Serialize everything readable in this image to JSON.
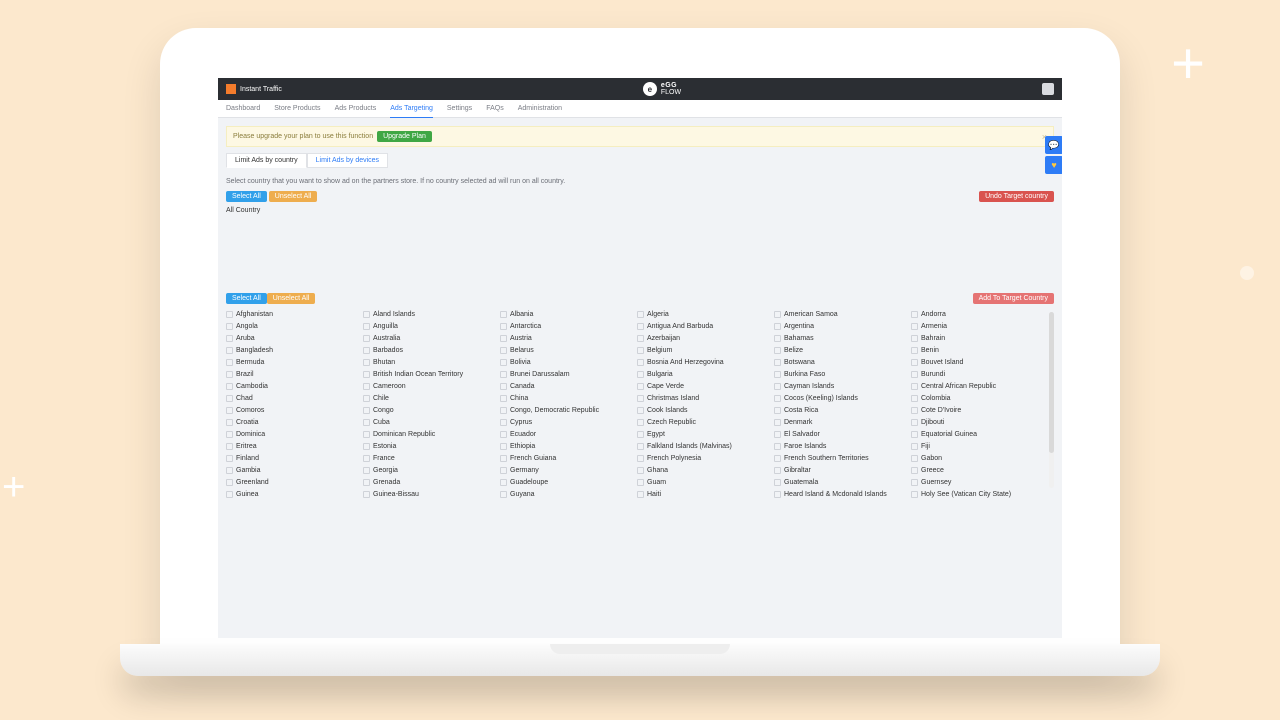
{
  "header": {
    "app_title": "Instant Traffic",
    "brand_line1": "eGG",
    "brand_line2": "FLOW"
  },
  "nav": {
    "items": [
      "Dashboard",
      "Store Products",
      "Ads Products",
      "Ads Targeting",
      "Settings",
      "FAQs",
      "Administration"
    ]
  },
  "alert": {
    "text": "Please upgrade your plan to use this function",
    "button": "Upgrade Plan"
  },
  "limit_tabs": [
    "Limit Ads by country",
    "Limit Ads by devices"
  ],
  "instructions": "Select country that you want to show ad on the partners store. If no country selected ad will run on all country.",
  "buttons": {
    "select_all": "Select All",
    "unselect_all": "Unselect All",
    "undo_target": "Undo Target country",
    "add_target": "Add To Target Country"
  },
  "all_country_label": "All Country",
  "countries": [
    [
      "Afghanistan",
      "Aland Islands",
      "Albania",
      "Algeria",
      "American Samoa",
      "Andorra"
    ],
    [
      "Angola",
      "Anguilla",
      "Antarctica",
      "Antigua And Barbuda",
      "Argentina",
      "Armenia"
    ],
    [
      "Aruba",
      "Australia",
      "Austria",
      "Azerbaijan",
      "Bahamas",
      "Bahrain"
    ],
    [
      "Bangladesh",
      "Barbados",
      "Belarus",
      "Belgium",
      "Belize",
      "Benin"
    ],
    [
      "Bermuda",
      "Bhutan",
      "Bolivia",
      "Bosnia And Herzegovina",
      "Botswana",
      "Bouvet Island"
    ],
    [
      "Brazil",
      "British Indian Ocean Territory",
      "Brunei Darussalam",
      "Bulgaria",
      "Burkina Faso",
      "Burundi"
    ],
    [
      "Cambodia",
      "Cameroon",
      "Canada",
      "Cape Verde",
      "Cayman Islands",
      "Central African Republic"
    ],
    [
      "Chad",
      "Chile",
      "China",
      "Christmas Island",
      "Cocos (Keeling) Islands",
      "Colombia"
    ],
    [
      "Comoros",
      "Congo",
      "Congo, Democratic Republic",
      "Cook Islands",
      "Costa Rica",
      "Cote D'Ivoire"
    ],
    [
      "Croatia",
      "Cuba",
      "Cyprus",
      "Czech Republic",
      "Denmark",
      "Djibouti"
    ],
    [
      "Dominica",
      "Dominican Republic",
      "Ecuador",
      "Egypt",
      "El Salvador",
      "Equatorial Guinea"
    ],
    [
      "Eritrea",
      "Estonia",
      "Ethiopia",
      "Falkland Islands (Malvinas)",
      "Faroe Islands",
      "Fiji"
    ],
    [
      "Finland",
      "France",
      "French Guiana",
      "French Polynesia",
      "French Southern Territories",
      "Gabon"
    ],
    [
      "Gambia",
      "Georgia",
      "Germany",
      "Ghana",
      "Gibraltar",
      "Greece"
    ],
    [
      "Greenland",
      "Grenada",
      "Guadeloupe",
      "Guam",
      "Guatemala",
      "Guernsey"
    ],
    [
      "Guinea",
      "Guinea-Bissau",
      "Guyana",
      "Haiti",
      "Heard Island & Mcdonald Islands",
      "Holy See (Vatican City State)"
    ]
  ]
}
